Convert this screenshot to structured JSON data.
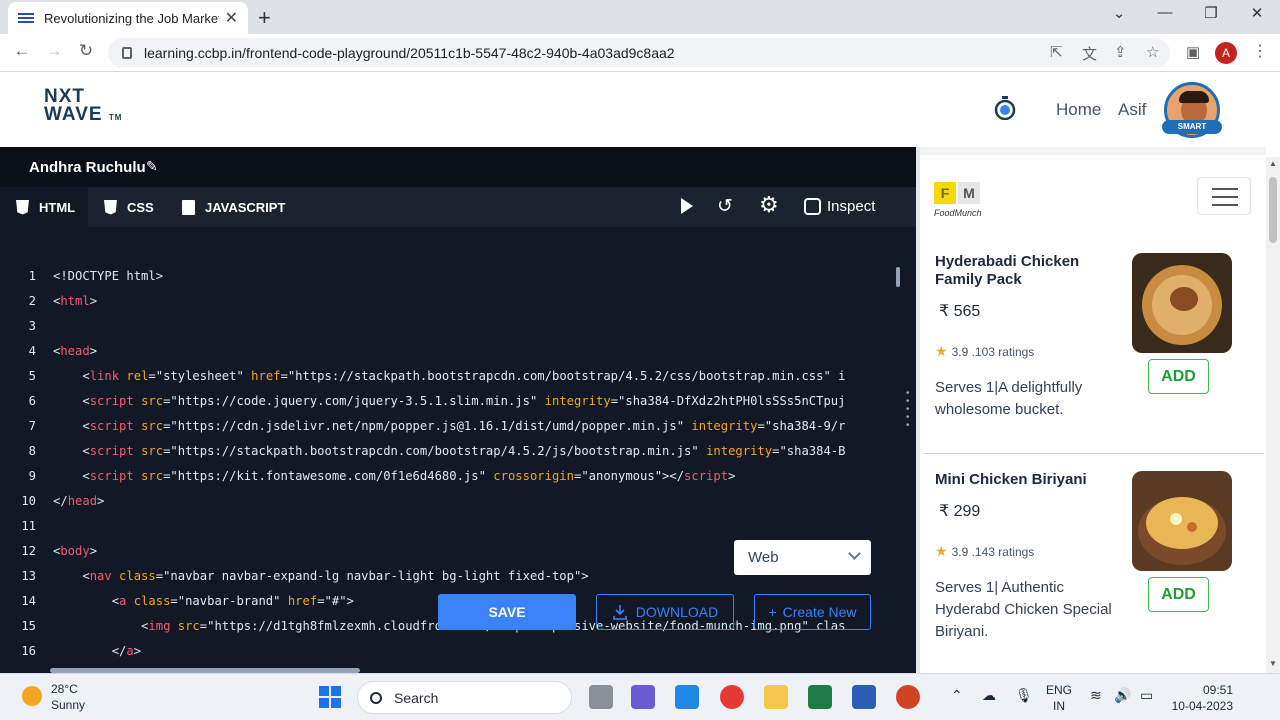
{
  "browser": {
    "tab_title": "Revolutionizing the Job Market |",
    "url": "learning.ccbp.in/frontend-code-playground/20511c1b-5547-48c2-940b-4a03ad9c8aa2",
    "profile_initial": "A"
  },
  "site": {
    "logo_line1": "NXT",
    "logo_line2": "WAVE",
    "logo_tm": "TM",
    "nav_home": "Home",
    "nav_user": "Asif",
    "avatar_badge": "SMART"
  },
  "editor": {
    "project_name": "Andhra Ruchulu",
    "tabs": [
      {
        "label": "HTML"
      },
      {
        "label": "CSS"
      },
      {
        "label": "JAVASCRIPT"
      }
    ],
    "inspect_label": "Inspect",
    "view_mode": "Web",
    "save_label": "SAVE",
    "download_label": "DOWNLOAD",
    "create_label": "Create New",
    "lines": [
      {
        "n": "1",
        "parts": [
          [
            "t",
            "<!DOCTYPE html>"
          ]
        ]
      },
      {
        "n": "2",
        "parts": [
          [
            "t",
            "<"
          ],
          [
            "tag",
            "html"
          ],
          [
            "t",
            ">"
          ]
        ]
      },
      {
        "n": "3",
        "parts": []
      },
      {
        "n": "4",
        "parts": [
          [
            "t",
            "<"
          ],
          [
            "tag",
            "head"
          ],
          [
            "t",
            ">"
          ]
        ]
      },
      {
        "n": "5",
        "parts": [
          [
            "t",
            "    <"
          ],
          [
            "tag",
            "link"
          ],
          [
            "t",
            " "
          ],
          [
            "attr",
            "rel"
          ],
          [
            "t",
            "=\"stylesheet\" "
          ],
          [
            "attr",
            "href"
          ],
          [
            "t",
            "=\"https://stackpath.bootstrapcdn.com/bootstrap/4.5.2/css/bootstrap.min.css\" i"
          ]
        ]
      },
      {
        "n": "6",
        "parts": [
          [
            "t",
            "    <"
          ],
          [
            "tag",
            "script"
          ],
          [
            "t",
            " "
          ],
          [
            "attr",
            "src"
          ],
          [
            "t",
            "=\"https://code.jquery.com/jquery-3.5.1.slim.min.js\" "
          ],
          [
            "attr",
            "integrity"
          ],
          [
            "t",
            "=\"sha384-DfXdz2htPH0lsSSs5nCTpuj"
          ]
        ]
      },
      {
        "n": "7",
        "parts": [
          [
            "t",
            "    <"
          ],
          [
            "tag",
            "script"
          ],
          [
            "t",
            " "
          ],
          [
            "attr",
            "src"
          ],
          [
            "t",
            "=\"https://cdn.jsdelivr.net/npm/popper.js@1.16.1/dist/umd/popper.min.js\" "
          ],
          [
            "attr",
            "integrity"
          ],
          [
            "t",
            "=\"sha384-9/r"
          ]
        ]
      },
      {
        "n": "8",
        "parts": [
          [
            "t",
            "    <"
          ],
          [
            "tag",
            "script"
          ],
          [
            "t",
            " "
          ],
          [
            "attr",
            "src"
          ],
          [
            "t",
            "=\"https://stackpath.bootstrapcdn.com/bootstrap/4.5.2/js/bootstrap.min.js\" "
          ],
          [
            "attr",
            "integrity"
          ],
          [
            "t",
            "=\"sha384-B"
          ]
        ]
      },
      {
        "n": "9",
        "parts": [
          [
            "t",
            "    <"
          ],
          [
            "tag",
            "script"
          ],
          [
            "t",
            " "
          ],
          [
            "attr",
            "src"
          ],
          [
            "t",
            "=\"https://kit.fontawesome.com/0f1e6d4680.js\" "
          ],
          [
            "attr",
            "crossorigin"
          ],
          [
            "t",
            "=\"anonymous\"></"
          ],
          [
            "tag",
            "script"
          ],
          [
            "t",
            ">"
          ]
        ]
      },
      {
        "n": "10",
        "parts": [
          [
            "t",
            "</"
          ],
          [
            "tag",
            "head"
          ],
          [
            "t",
            ">"
          ]
        ]
      },
      {
        "n": "11",
        "parts": []
      },
      {
        "n": "12",
        "parts": [
          [
            "t",
            "<"
          ],
          [
            "tag",
            "body"
          ],
          [
            "t",
            ">"
          ]
        ]
      },
      {
        "n": "13",
        "parts": [
          [
            "t",
            "    <"
          ],
          [
            "tag",
            "nav"
          ],
          [
            "t",
            " "
          ],
          [
            "attr",
            "class"
          ],
          [
            "t",
            "=\"navbar navbar-expand-lg navbar-light bg-light fixed-top\">"
          ]
        ]
      },
      {
        "n": "14",
        "parts": [
          [
            "t",
            "        <"
          ],
          [
            "tag",
            "a"
          ],
          [
            "t",
            " "
          ],
          [
            "attr",
            "class"
          ],
          [
            "t",
            "=\"navbar-brand\" "
          ],
          [
            "attr",
            "href"
          ],
          [
            "t",
            "=\"#\">"
          ]
        ]
      },
      {
        "n": "15",
        "parts": [
          [
            "t",
            "            <"
          ],
          [
            "tag",
            "img"
          ],
          [
            "t",
            " "
          ],
          [
            "attr",
            "src"
          ],
          [
            "t",
            "=\"https://d1tgh8fmlzexmh.cloudfront.net/ccbp-responsive-website/food-munch-img.png\" clas"
          ]
        ]
      },
      {
        "n": "16",
        "parts": [
          [
            "t",
            "        </"
          ],
          [
            "tag",
            "a"
          ],
          [
            "t",
            ">"
          ]
        ]
      }
    ]
  },
  "preview": {
    "logo_f": "F",
    "logo_m": "M",
    "logo_text": "FoodMunch",
    "items": [
      {
        "name": "Hyderabadi Chicken Family Pack",
        "price": "₹ 565",
        "rating": "3.9 .103 ratings",
        "desc": "Serves 1|A delightfully wholesome bucket.",
        "add": "ADD"
      },
      {
        "name": "Mini Chicken Biriyani",
        "price": "₹ 299",
        "rating": "3.9 .143 ratings",
        "desc": "Serves 1| Authentic Hyderabd Chicken Special Biriyani.",
        "add": "ADD"
      }
    ]
  },
  "taskbar": {
    "temp": "28°C",
    "condition": "Sunny",
    "search_label": "Search",
    "lang1": "ENG",
    "lang2": "IN",
    "time": "09:51",
    "date": "10-04-2023"
  },
  "colors": {
    "editor_bg": "#121826",
    "tag": "#f25c6e",
    "attr": "#f5a524",
    "accent": "#3b82f6",
    "add_green": "#1e9e36"
  }
}
